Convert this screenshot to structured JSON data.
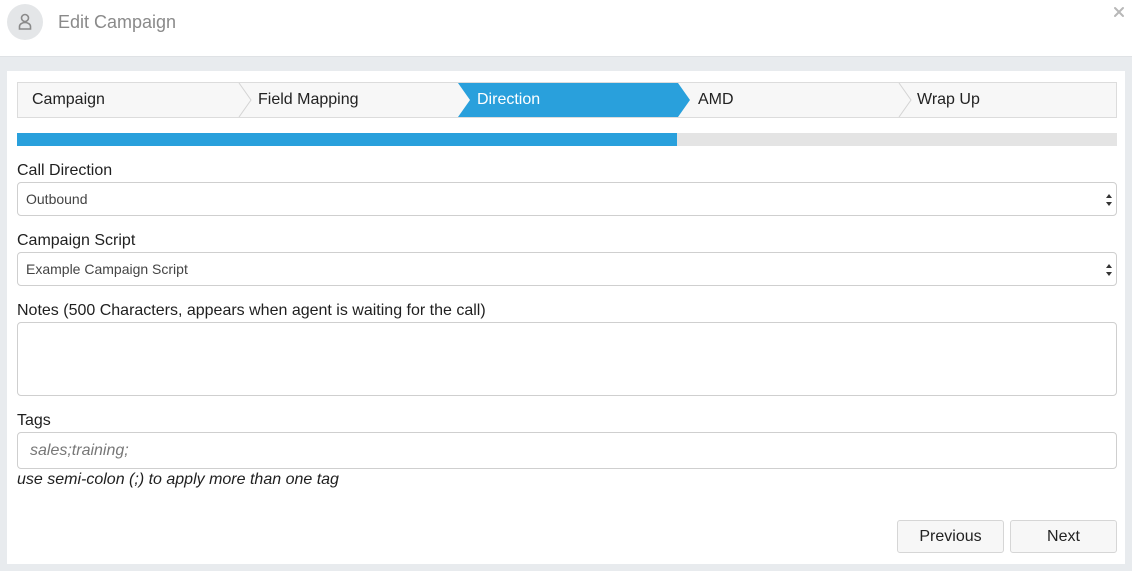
{
  "header": {
    "title": "Edit Campaign",
    "avatar_icon": "user-icon",
    "close_icon": "close-icon"
  },
  "wizard": {
    "steps": [
      {
        "label": "Campaign",
        "active": false
      },
      {
        "label": "Field Mapping",
        "active": false
      },
      {
        "label": "Direction",
        "active": true
      },
      {
        "label": "AMD",
        "active": false
      },
      {
        "label": "Wrap Up",
        "active": false
      }
    ],
    "progress_fraction": 0.6
  },
  "form": {
    "call_direction": {
      "label": "Call Direction",
      "value": "Outbound"
    },
    "campaign_script": {
      "label": "Campaign Script",
      "value": "Example Campaign Script"
    },
    "notes": {
      "label": "Notes (500 Characters, appears when agent is waiting for the call)",
      "value": ""
    },
    "tags": {
      "label": "Tags",
      "placeholder": "sales;training;",
      "hint": "use semi-colon (;) to apply more than one tag"
    }
  },
  "buttons": {
    "previous": "Previous",
    "next": "Next"
  },
  "colors": {
    "accent": "#29a0dc"
  }
}
